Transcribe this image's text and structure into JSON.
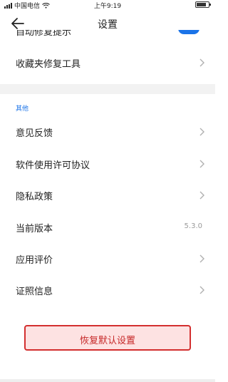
{
  "status_bar": {
    "carrier": "中国电信",
    "time": "上午9:19"
  },
  "header": {
    "title": "设置"
  },
  "settings": {
    "cut_item": "自动修复提示",
    "repair_tool": "收藏夹修复工具",
    "section_other": "其他",
    "items": [
      {
        "label": "意见反馈"
      },
      {
        "label": "软件使用许可协议"
      },
      {
        "label": "隐私政策"
      },
      {
        "label": "当前版本",
        "value": "5.3.0"
      },
      {
        "label": "应用评价"
      },
      {
        "label": "证照信息"
      }
    ]
  },
  "actions": {
    "reset_label": "恢复默认设置"
  },
  "colors": {
    "accent": "#1a73e8",
    "danger": "#d32f2f",
    "danger_bg": "#fde2e2"
  },
  "icons": {
    "back": "arrow-left-icon",
    "chevron": "chevron-right-icon",
    "wifi": "wifi-icon",
    "battery": "battery-icon"
  }
}
